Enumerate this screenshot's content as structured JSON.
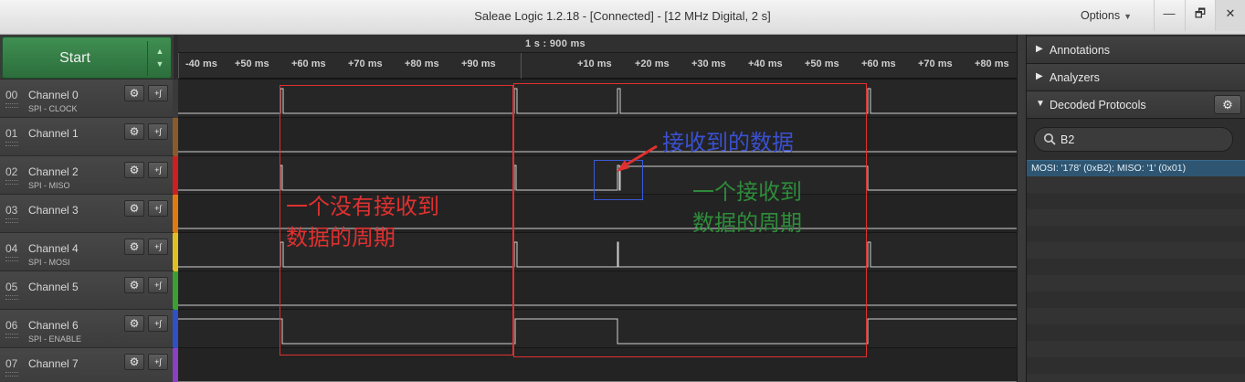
{
  "window": {
    "title": "Saleae Logic 1.2.18 - [Connected] - [12 MHz Digital, 2 s]",
    "options_label": "Options",
    "buttons": [
      "—",
      "🗗",
      "✕"
    ]
  },
  "start_button": {
    "label": "Start"
  },
  "channels": [
    {
      "num": "00",
      "name": "Channel 0",
      "sub": "SPI - CLOCK",
      "color": "#3a3a3a"
    },
    {
      "num": "01",
      "name": "Channel 1",
      "sub": "",
      "color": "#8b5a2b"
    },
    {
      "num": "02",
      "name": "Channel 2",
      "sub": "SPI - MISO",
      "color": "#cc2020"
    },
    {
      "num": "03",
      "name": "Channel 3",
      "sub": "",
      "color": "#e07a10"
    },
    {
      "num": "04",
      "name": "Channel 4",
      "sub": "SPI - MOSI",
      "color": "#e0c020"
    },
    {
      "num": "05",
      "name": "Channel 5",
      "sub": "",
      "color": "#3aa030"
    },
    {
      "num": "06",
      "name": "Channel 6",
      "sub": "SPI - ENABLE",
      "color": "#3050c8"
    },
    {
      "num": "07",
      "name": "Channel 7",
      "sub": "",
      "color": "#8a40c0"
    }
  ],
  "timeline": {
    "top_label": "1 s : 900 ms",
    "ticks": [
      "-40 ms",
      "+50 ms",
      "+60 ms",
      "+70 ms",
      "+80 ms",
      "+90 ms",
      "+10 ms",
      "+20 ms",
      "+30 ms",
      "+40 ms",
      "+50 ms",
      "+60 ms",
      "+70 ms",
      "+80 ms"
    ]
  },
  "annotations": {
    "no_data_cycle": [
      "一个没有接收到",
      "数据的周期"
    ],
    "data_cycle": [
      "一个接收到",
      "数据的周期"
    ],
    "received_data": "接收到的数据",
    "colors": {
      "red": "#e03030",
      "green": "#2e8b3a",
      "blue": "#3a50d0"
    }
  },
  "right_panel": {
    "annotations_label": "Annotations",
    "analyzers_label": "Analyzers",
    "decoded_label": "Decoded Protocols",
    "search_value": "B2",
    "search_placeholder": "",
    "results": [
      "MOSI: '178' (0xB2);  MISO: '1' (0x01)"
    ]
  }
}
